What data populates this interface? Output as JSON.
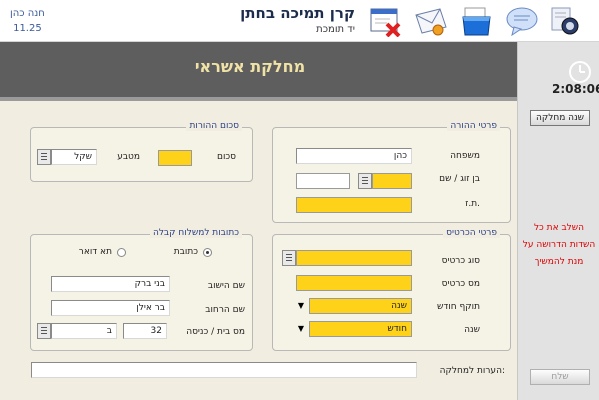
{
  "header": {
    "user_name": "חנה כהן",
    "user_version": "11.25",
    "org_title": "קרן תמיכה בחתן",
    "org_subtitle": "יד תומכת",
    "toolbar_icons": [
      "settings-icon",
      "chat-bubble-icon",
      "folder-icon",
      "mail-icon",
      "cancel-window-icon"
    ]
  },
  "sidebar": {
    "clock_time": "2:08:06",
    "change_dept_label": "שנה מחלקה",
    "warning_note": "השלב את כל השדות הדרושה על מנת להמשיך",
    "send_label": "שלח"
  },
  "page": {
    "title": "מחלקת אשראי"
  },
  "payer": {
    "title": "פרטי ההורה",
    "family_label": "משפחה",
    "family_value": "כהן",
    "spouse_label": "בן זוג / שם",
    "spouse_value": "",
    "id_label": "ת.ז.",
    "id_value": ""
  },
  "amount": {
    "title": "סכום ההורות",
    "sum_label": "סכום",
    "sum_value": "",
    "currency_label": "מטבע",
    "currency_value": "שקל"
  },
  "card": {
    "title": "פרטי הכרטיס",
    "type_label": "סוג כרטיס",
    "type_value": "",
    "number_label": "מס כרטיס",
    "number_value": "",
    "month_label": "תוקף חודש",
    "month_value": "שנה",
    "year_label": "שנה",
    "year_value": "חודש"
  },
  "address": {
    "title": "כתובות למשלוח קבלה",
    "option_address": "כתובת",
    "option_mail": "תא דואר",
    "city_label": "שם הישוב",
    "city_value": "בני ברק",
    "street_label": "שם הרחוב",
    "street_value": "בר אילן",
    "house_label": "מס בית / כניסה",
    "house_value": "32",
    "entrance_value": "ב"
  },
  "notes": {
    "label": "הערות למחלקה:",
    "value": ""
  }
}
